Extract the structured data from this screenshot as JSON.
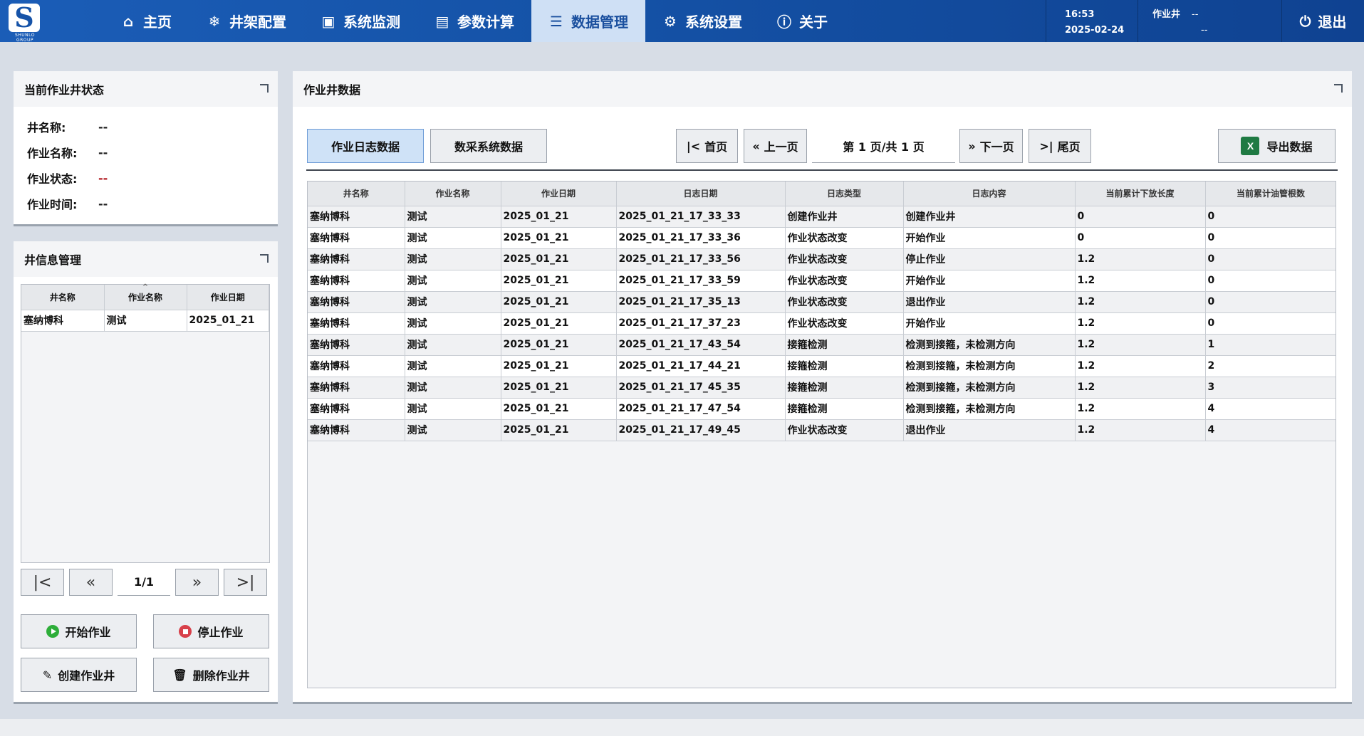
{
  "app": {
    "logo_text": "S",
    "logo_sub": "SHUNLO GROUP"
  },
  "nav": {
    "items": [
      {
        "label": "主页",
        "icon": "home-icon"
      },
      {
        "label": "井架配置",
        "icon": "rig-config-icon"
      },
      {
        "label": "系统监测",
        "icon": "monitor-icon"
      },
      {
        "label": "参数计算",
        "icon": "calculator-icon"
      },
      {
        "label": "数据管理",
        "icon": "database-icon",
        "active": true
      },
      {
        "label": "系统设置",
        "icon": "gear-icon"
      },
      {
        "label": "关于",
        "icon": "info-icon"
      }
    ],
    "time": "16:53",
    "date": "2025-02-24",
    "well_label": "作业井",
    "well_value_1": "--",
    "well_value_2": "--",
    "logout_label": "退出"
  },
  "status_panel": {
    "title": "当前作业井状态",
    "rows": [
      {
        "key": "井名称:",
        "value": "--"
      },
      {
        "key": "作业名称:",
        "value": "--"
      },
      {
        "key": "作业状态:",
        "value": "--"
      },
      {
        "key": "作业时间:",
        "value": "--"
      }
    ]
  },
  "well_info": {
    "title": "井信息管理",
    "columns": [
      "井名称",
      "作业名称",
      "作业日期"
    ],
    "rows": [
      [
        "塞纳博科",
        "测试",
        "2025_01_21"
      ]
    ],
    "page_text": "1/1",
    "start_label": "开始作业",
    "stop_label": "停止作业",
    "create_label": "创建作业井",
    "delete_label": "删除作业井"
  },
  "data_panel": {
    "title": "作业井数据",
    "tab_log": "作业日志数据",
    "tab_acq": "数采系统数据",
    "first_label": "首页",
    "prev_label": "上一页",
    "page_info": "第 1 页/共 1 页",
    "next_label": "下一页",
    "last_label": "尾页",
    "export_label": "导出数据",
    "columns": [
      "井名称",
      "作业名称",
      "作业日期",
      "日志日期",
      "日志类型",
      "日志内容",
      "当前累计下放长度",
      "当前累计油管根数"
    ],
    "rows": [
      [
        "塞纳博科",
        "测试",
        "2025_01_21",
        "2025_01_21_17_33_33",
        "创建作业井",
        "创建作业井",
        "0",
        "0"
      ],
      [
        "塞纳博科",
        "测试",
        "2025_01_21",
        "2025_01_21_17_33_36",
        "作业状态改变",
        "开始作业",
        "0",
        "0"
      ],
      [
        "塞纳博科",
        "测试",
        "2025_01_21",
        "2025_01_21_17_33_56",
        "作业状态改变",
        "停止作业",
        "1.2",
        "0"
      ],
      [
        "塞纳博科",
        "测试",
        "2025_01_21",
        "2025_01_21_17_33_59",
        "作业状态改变",
        "开始作业",
        "1.2",
        "0"
      ],
      [
        "塞纳博科",
        "测试",
        "2025_01_21",
        "2025_01_21_17_35_13",
        "作业状态改变",
        "退出作业",
        "1.2",
        "0"
      ],
      [
        "塞纳博科",
        "测试",
        "2025_01_21",
        "2025_01_21_17_37_23",
        "作业状态改变",
        "开始作业",
        "1.2",
        "0"
      ],
      [
        "塞纳博科",
        "测试",
        "2025_01_21",
        "2025_01_21_17_43_54",
        "接箍检测",
        "检测到接箍，未检测方向",
        "1.2",
        "1"
      ],
      [
        "塞纳博科",
        "测试",
        "2025_01_21",
        "2025_01_21_17_44_21",
        "接箍检测",
        "检测到接箍，未检测方向",
        "1.2",
        "2"
      ],
      [
        "塞纳博科",
        "测试",
        "2025_01_21",
        "2025_01_21_17_45_35",
        "接箍检测",
        "检测到接箍，未检测方向",
        "1.2",
        "3"
      ],
      [
        "塞纳博科",
        "测试",
        "2025_01_21",
        "2025_01_21_17_47_54",
        "接箍检测",
        "检测到接箍，未检测方向",
        "1.2",
        "4"
      ],
      [
        "塞纳博科",
        "测试",
        "2025_01_21",
        "2025_01_21_17_49_45",
        "作业状态改变",
        "退出作业",
        "1.2",
        "4"
      ]
    ]
  }
}
